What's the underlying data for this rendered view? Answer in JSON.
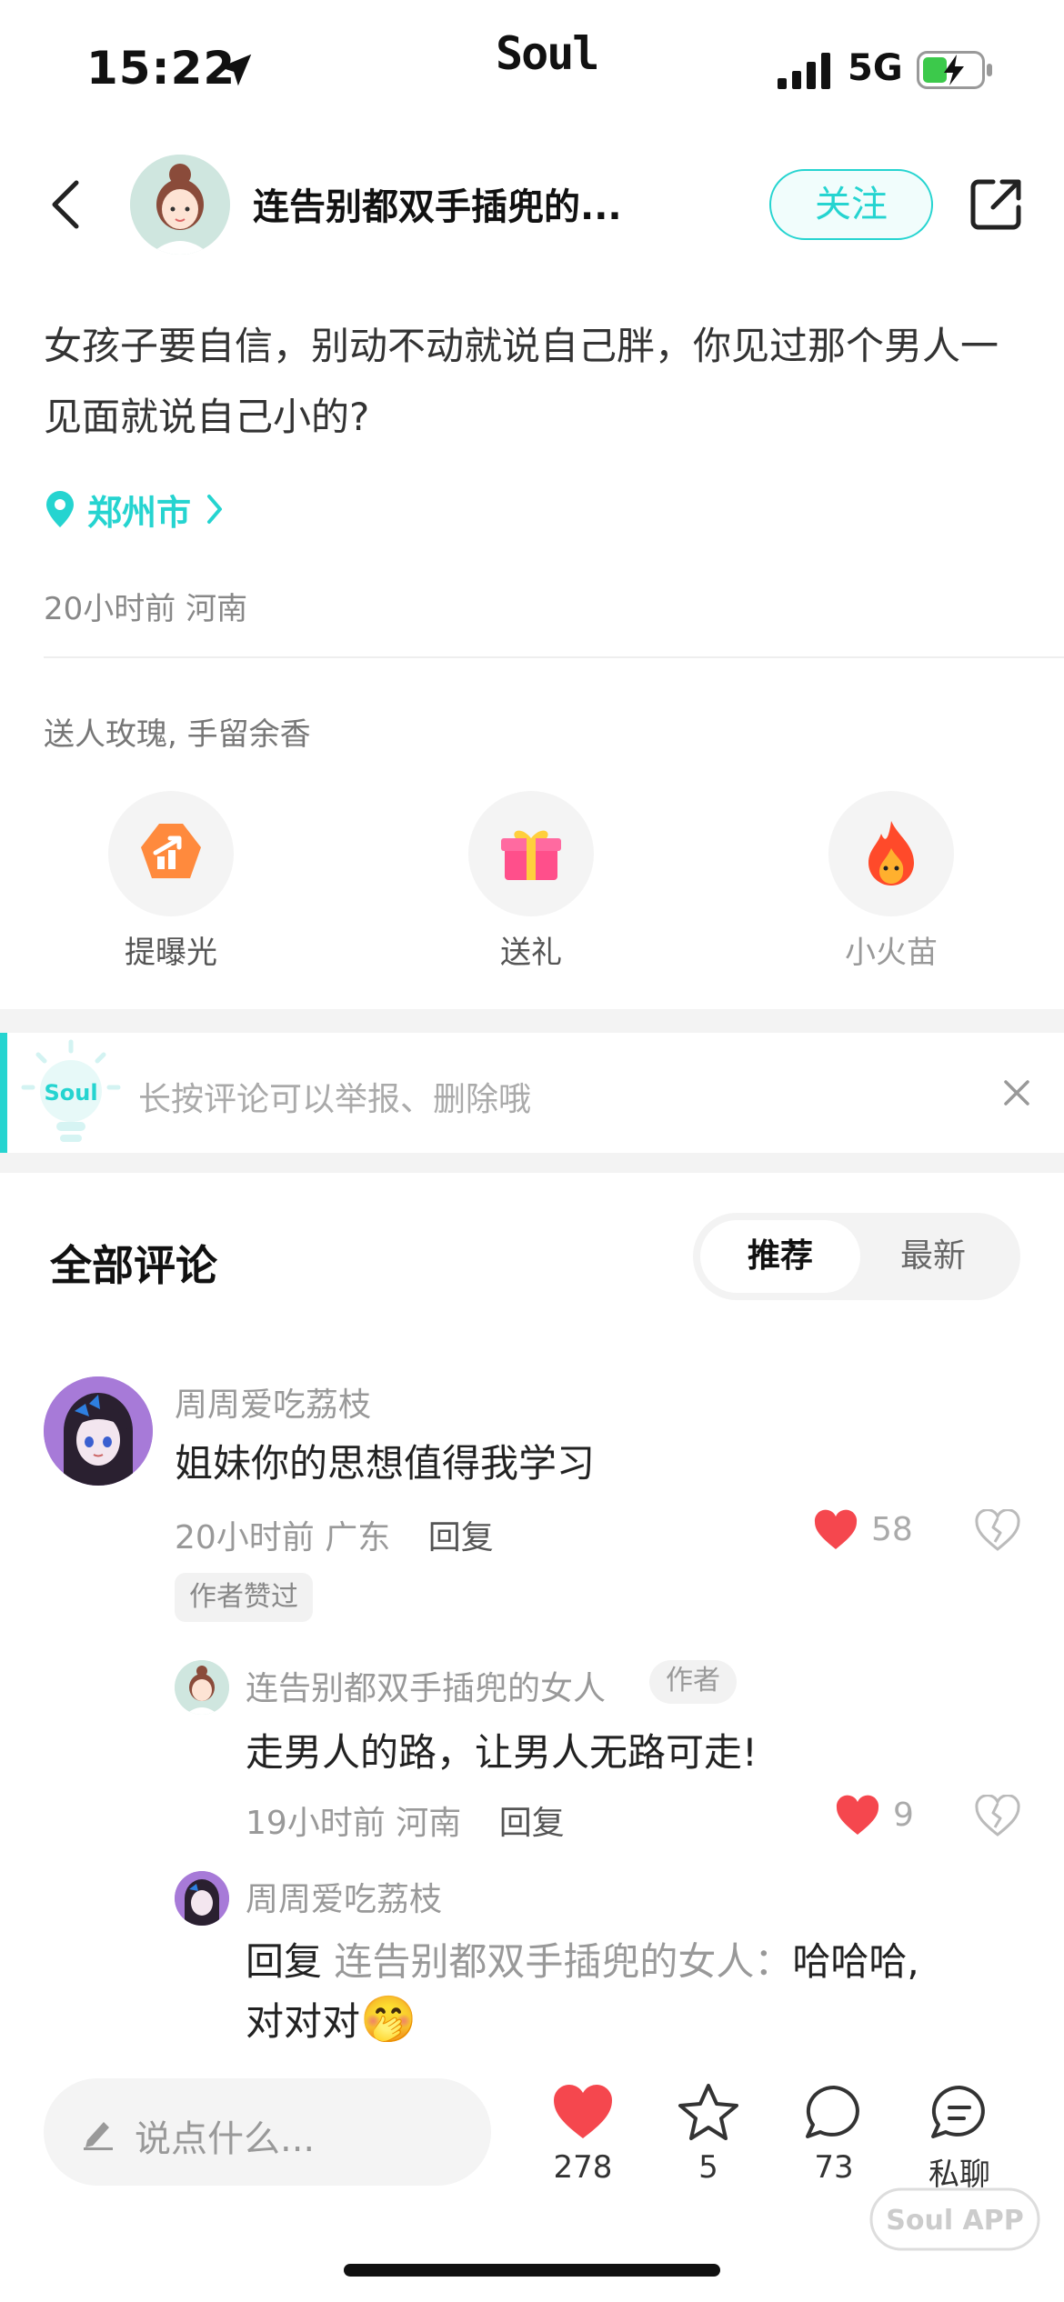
{
  "status_bar": {
    "time": "15:22",
    "brand": "Soul",
    "network": "5G"
  },
  "header": {
    "author_name": "连告别都双手插兜的...",
    "follow_label": "关注"
  },
  "post": {
    "text": "女孩子要自信，别动不动就说自己胖，你见过那个男人一见面就说自己小的?",
    "location": "郑州市",
    "time": "20小时前",
    "region": "河南"
  },
  "gifts": {
    "caption": "送人玫瑰, 手留余香",
    "actions": [
      {
        "label": "提曝光",
        "icon": "boost-icon"
      },
      {
        "label": "送礼",
        "icon": "gift-icon"
      },
      {
        "label": "小火苗",
        "icon": "flame-icon"
      }
    ]
  },
  "tip": {
    "badge": "Soul",
    "text": "长按评论可以举报、删除哦"
  },
  "comments_header": {
    "title": "全部评论",
    "tabs": [
      "推荐",
      "最新"
    ],
    "active_tab": "推荐"
  },
  "comments": [
    {
      "name": "周周爱吃荔枝",
      "text": "姐妹你的思想值得我学习",
      "time": "20小时前",
      "region": "广东",
      "reply_label": "回复",
      "likes": "58",
      "badge": "作者赞过"
    }
  ],
  "replies": [
    {
      "name": "连告别都双手插兜的女人",
      "tag": "作者",
      "text": "走男人的路，让男人无路可走!",
      "time": "19小时前",
      "region": "河南",
      "reply_label": "回复",
      "likes": "9"
    },
    {
      "name": "周周爱吃荔枝",
      "prefix": "回复",
      "target": "连告别都双手插兜的女人：",
      "text_line1": "哈哈哈,",
      "text_line2": "对对对",
      "emoji": "🤭"
    }
  ],
  "bottom_bar": {
    "placeholder": "说点什么...",
    "likes": "278",
    "favorites": "5",
    "comments": "73",
    "chat_label": "私聊"
  },
  "watermark": "Soul APP",
  "colors": {
    "accent": "#25d4d0",
    "like": "#f5474e"
  }
}
